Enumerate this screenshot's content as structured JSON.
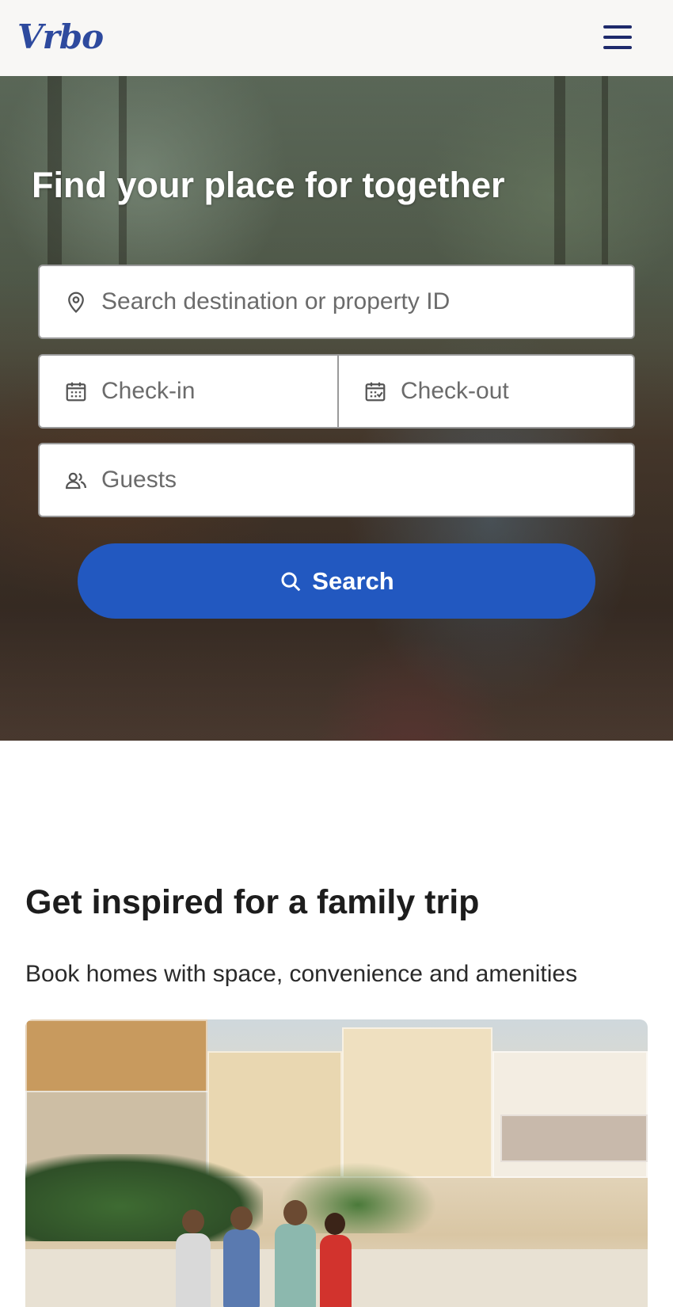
{
  "header": {
    "logo_text": "Vrbo",
    "menu_icon": "hamburger-menu-icon",
    "background": "#f8f7f5",
    "logo_color": "#2e4a9e"
  },
  "hero": {
    "title": "Find your place for together",
    "search": {
      "destination_placeholder": "Search destination or property ID",
      "destination_icon": "map-pin-icon",
      "checkin_placeholder": "Check-in",
      "checkin_icon": "calendar-icon",
      "checkout_placeholder": "Check-out",
      "checkout_icon": "calendar-check-icon",
      "guests_placeholder": "Guests",
      "guests_icon": "users-icon",
      "button_label": "Search",
      "button_icon": "search-icon",
      "button_color": "#2258c0"
    }
  },
  "inspiration": {
    "title": "Get inspired for a family trip",
    "subtitle": "Book homes with space, convenience and amenities",
    "image_alt": "Family walking on beach in front of beach houses"
  }
}
